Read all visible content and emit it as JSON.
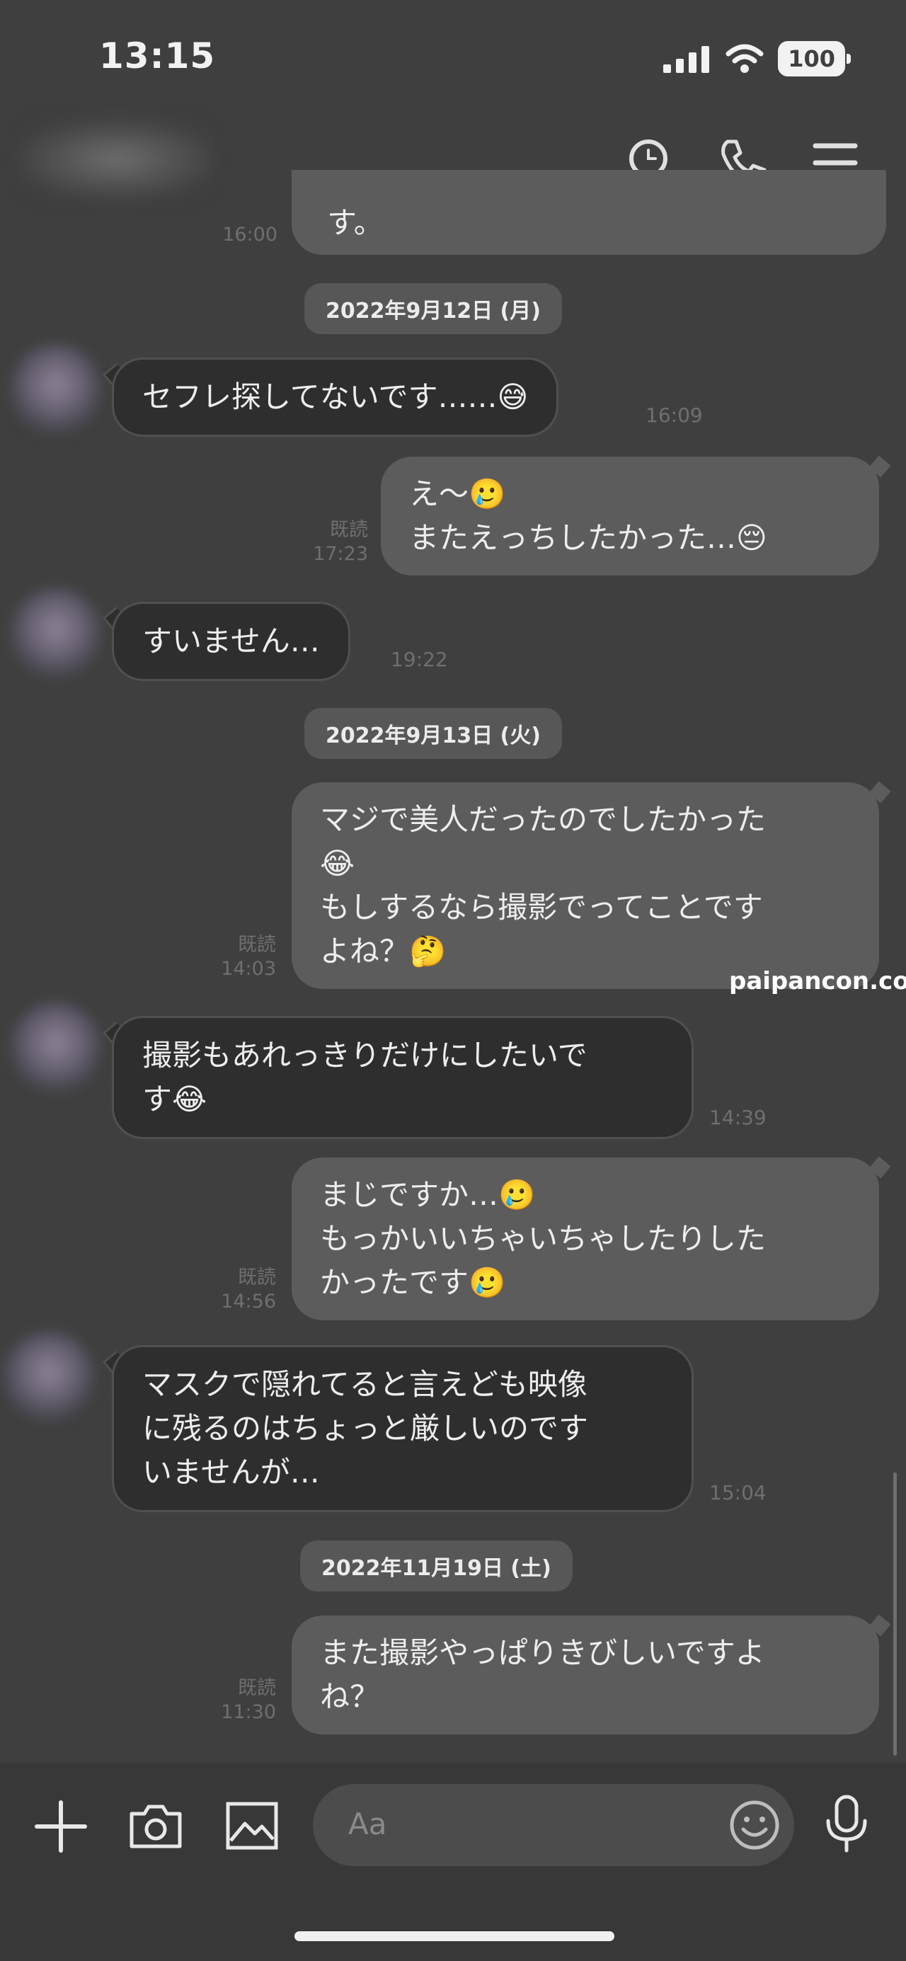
{
  "status_bar": {
    "time": "13:15",
    "battery": "100"
  },
  "messages": {
    "top_fragment": {
      "text": "す。",
      "time": "16:00"
    },
    "date1": "2022年9月12日 (月)",
    "m1": {
      "text": "セフレ探してないです……😅",
      "time": "16:09"
    },
    "m2": {
      "text": "え〜🥲\nまたえっちしたかった…😔",
      "read": "既読",
      "time": "17:23"
    },
    "m3": {
      "text": "すいません…",
      "time": "19:22"
    },
    "date2": "2022年9月13日 (火)",
    "m4": {
      "text": "マジで美人だったのでしたかった\n😂\nもしするなら撮影でってことです\nよね？🤔",
      "read": "既読",
      "time": "14:03"
    },
    "m5": {
      "text": "撮影もあれっきりだけにしたいで\nす😂",
      "time": "14:39"
    },
    "m6": {
      "text": "まじですか…🥲\nもっかいいちゃいちゃしたりした\nかったです🥲",
      "read": "既読",
      "time": "14:56"
    },
    "m7": {
      "text": "マスクで隠れてると言えども映像\nに残るのはちょっと厳しいのです\nいませんが…",
      "time": "15:04"
    },
    "date3": "2022年11月19日 (土)",
    "m8": {
      "text": "また撮影やっぱりきびしいですよ\nね？",
      "read": "既読",
      "time": "11:30"
    }
  },
  "watermark": "paipancon.com",
  "input": {
    "placeholder": "Aa"
  },
  "icons": [
    "search-icon",
    "phone-icon",
    "menu-icon",
    "plus-icon",
    "camera-icon",
    "image-icon",
    "emoji-icon",
    "mic-icon"
  ]
}
